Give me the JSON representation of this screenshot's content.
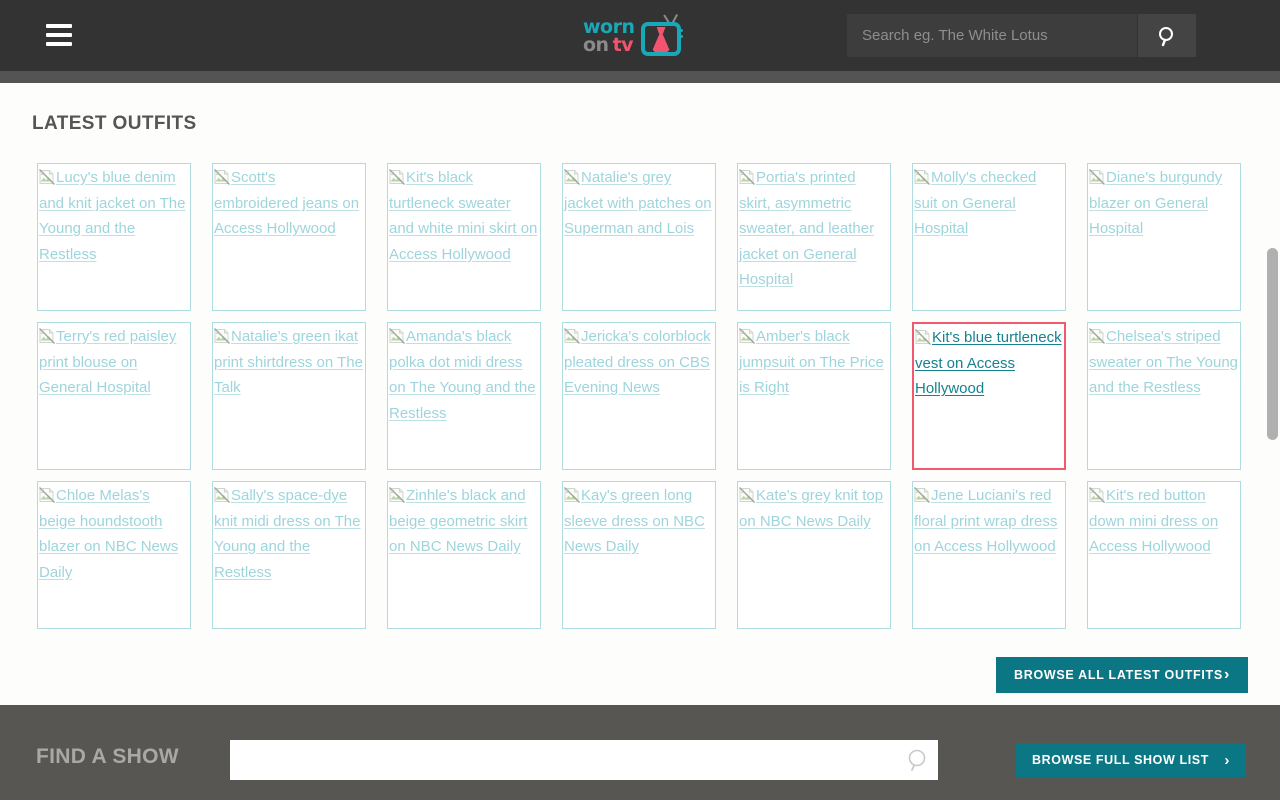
{
  "header": {
    "menu_icon": "hamburger-icon",
    "logo": {
      "word1": "worn",
      "word2": "on",
      "word3": "tv",
      "tv_icon": "tv-with-dress-icon",
      "teal": "#18A9B8",
      "grey": "#8a8a8a",
      "pink": "#F2546F"
    },
    "search": {
      "placeholder": "Search eg. The White Lotus",
      "value": "",
      "button_icon": "search-icon"
    }
  },
  "main": {
    "section_title": "LATEST OUTFITS",
    "browse_button": {
      "label": "BROWSE ALL LATEST OUTFITS",
      "chevron": "›"
    },
    "cards": [
      {
        "alt": "Lucy's blue denim and knit jacket on The Young and the Restless",
        "active": false
      },
      {
        "alt": "Scott's embroidered jeans on Access Hollywood",
        "active": false
      },
      {
        "alt": "Kit's black turtleneck sweater and white mini skirt on Access Hollywood",
        "active": false
      },
      {
        "alt": "Natalie's grey jacket with patches on Superman and Lois",
        "active": false
      },
      {
        "alt": "Portia's printed skirt, asymmetric sweater, and leather jacket on General Hospital",
        "active": false
      },
      {
        "alt": "Molly's checked suit on General Hospital",
        "active": false
      },
      {
        "alt": "Diane's burgundy blazer on General Hospital",
        "active": false
      },
      {
        "alt": "Terry's red paisley print blouse on General Hospital",
        "active": false
      },
      {
        "alt": "Natalie's green ikat print shirtdress on The Talk",
        "active": false
      },
      {
        "alt": "Amanda's black polka dot midi dress on The Young and the Restless",
        "active": false
      },
      {
        "alt": "Jericka's colorblock pleated dress on CBS Evening News",
        "active": false
      },
      {
        "alt": "Amber's black jumpsuit on The Price is Right",
        "active": false
      },
      {
        "alt": "Kit's blue turtleneck vest on Access Hollywood",
        "active": true
      },
      {
        "alt": "Chelsea's striped sweater on The Young and the Restless",
        "active": false
      },
      {
        "alt": "Chloe Melas's beige houndstooth blazer on NBC News Daily",
        "active": false
      },
      {
        "alt": "Sally's space-dye knit midi dress on The Young and the Restless",
        "active": false
      },
      {
        "alt": "Zinhle's black and beige geometric skirt on NBC News Daily",
        "active": false
      },
      {
        "alt": "Kay's green long sleeve dress on NBC News Daily",
        "active": false
      },
      {
        "alt": "Kate's grey knit top on NBC News Daily",
        "active": false
      },
      {
        "alt": "Jene Luciani's red floral print wrap dress on Access Hollywood",
        "active": false
      },
      {
        "alt": "Kit's red button down mini dress on Access Hollywood",
        "active": false
      }
    ]
  },
  "footer": {
    "find_label": "FIND A SHOW",
    "show_search": {
      "value": "",
      "placeholder": "",
      "icon": "search-icon"
    },
    "browse_button": {
      "label": "BROWSE FULL SHOW LIST",
      "chevron": "›"
    }
  },
  "colors": {
    "header_bg": "#333333",
    "accent_teal": "#0b7684",
    "link_teal": "#9ed5dd",
    "card_border": "#aedce0",
    "active_border": "#f2596f",
    "footer_bg": "#575653"
  }
}
